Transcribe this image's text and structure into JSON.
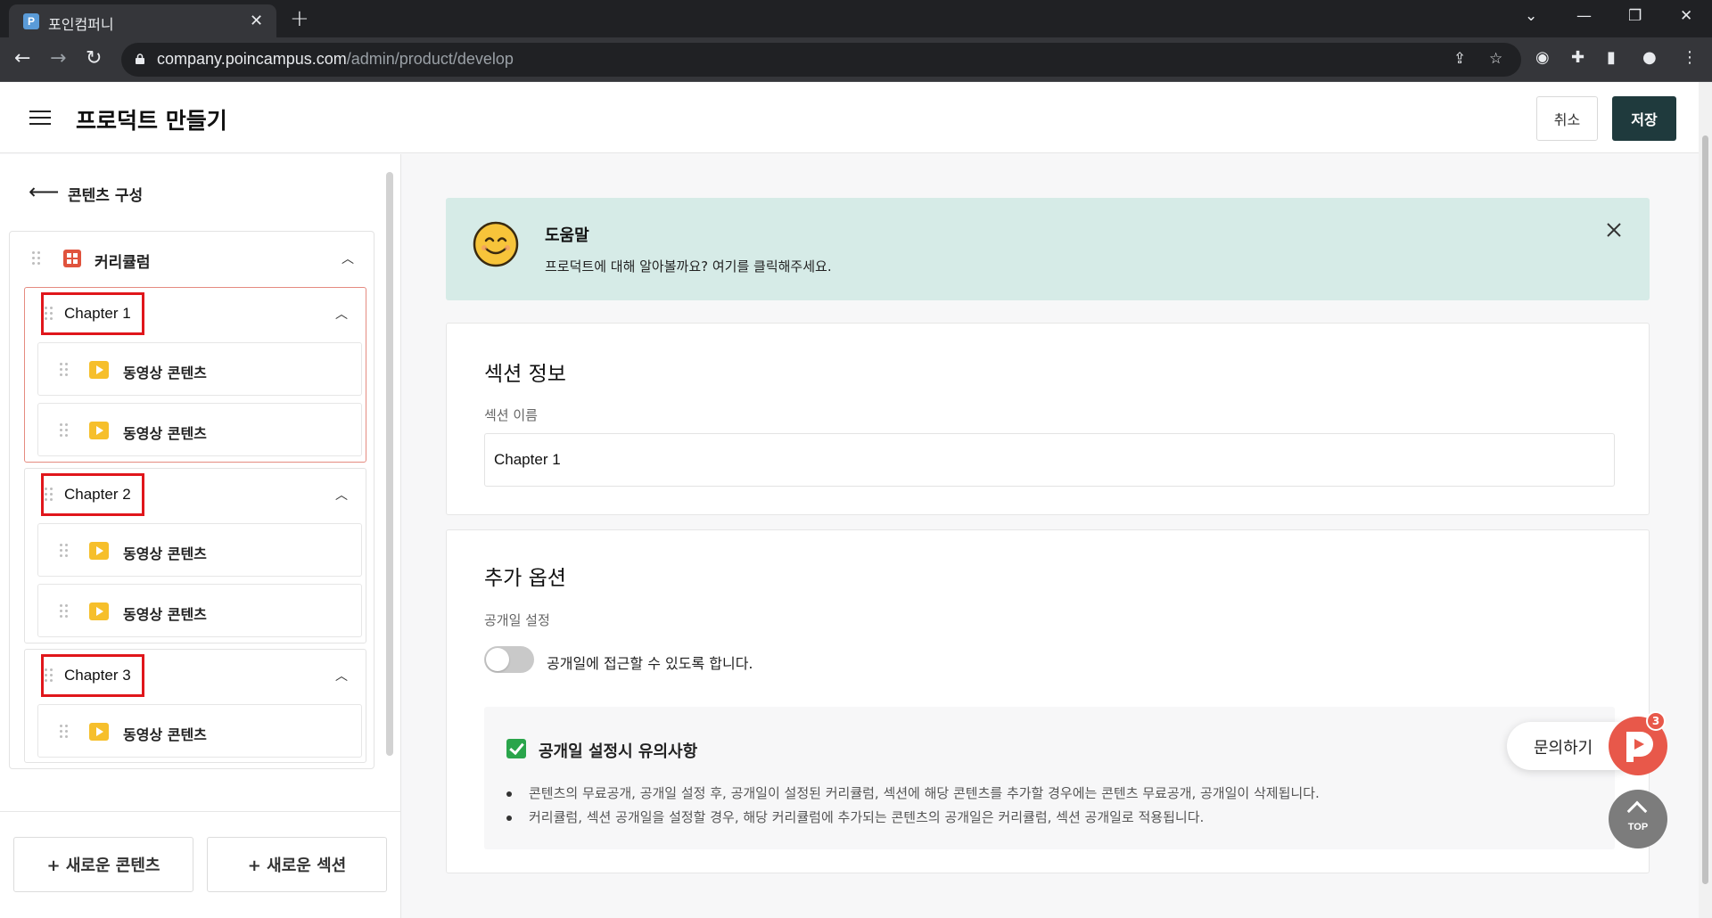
{
  "browser": {
    "tab_title": "포인컴퍼니",
    "tab_favicon": "P",
    "url_domain": "company.poincampus.com",
    "url_path": "/admin/product/develop"
  },
  "header": {
    "title": "프로덕트 만들기",
    "cancel_label": "취소",
    "save_label": "저장",
    "save_color": "#1f3a3d"
  },
  "sidebar": {
    "back_label": "콘텐츠 구성",
    "curriculum_label": "커리큘럼",
    "chapters": [
      {
        "label": "Chapter 1",
        "items": [
          "동영상 콘텐츠",
          "동영상 콘텐츠"
        ]
      },
      {
        "label": "Chapter 2",
        "items": [
          "동영상 콘텐츠",
          "동영상 콘텐츠"
        ]
      },
      {
        "label": "Chapter 3",
        "items": [
          "동영상 콘텐츠"
        ]
      }
    ],
    "new_content_label": "+ 새로운 콘텐츠",
    "new_section_label": "+ 새로운 섹션"
  },
  "help": {
    "title": "도움말",
    "text": "프로덕트에 대해 알아볼까요? 여기를 클릭해주세요.",
    "bg_color": "#d6ebe7"
  },
  "section_info": {
    "title": "섹션 정보",
    "name_label": "섹션 이름",
    "name_value": "Chapter 1"
  },
  "extra_options": {
    "title": "추가 옵션",
    "publish_label": "공개일 설정",
    "toggle_label": "공개일에 접근할 수 있도록 합니다.",
    "toggle_on": false,
    "notice_title": "공개일 설정시 유의사항",
    "notice_items": [
      "콘텐츠의 무료공개, 공개일 설정 후, 공개일이 설정된 커리큘럼, 섹션에 해당 콘텐츠를 추가할 경우에는 콘텐츠 무료공개, 공개일이 삭제됩니다.",
      "커리큘럼, 섹션 공개일을 설정할 경우, 해당 커리큘럼에 추가되는 콘텐츠의 공개일은 커리큘럼, 섹션 공개일로 적용됩니다."
    ]
  },
  "floating": {
    "inquiry_label": "문의하기",
    "inquiry_badge": "3",
    "top_label": "TOP"
  },
  "icons": {
    "menu": "hamburger-icon",
    "back": "arrow-left-icon",
    "drag": "drag-handle-icon",
    "curriculum": "grid-icon",
    "content": "play-icon",
    "collapse": "chevron-up-icon",
    "help": "smiley-icon",
    "close": "close-icon",
    "check": "checkbox-checked-icon"
  }
}
